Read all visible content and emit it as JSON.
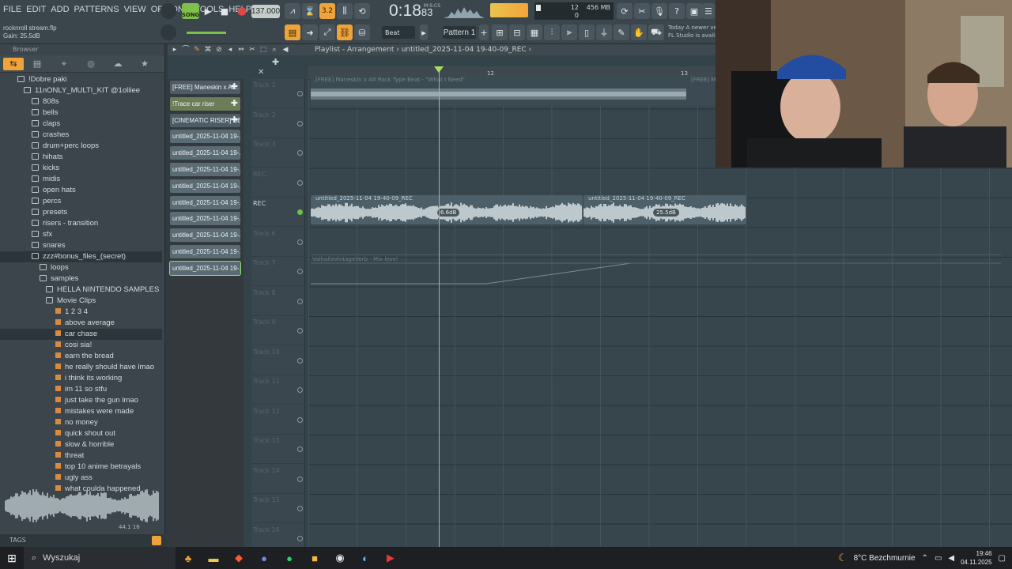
{
  "menu": [
    "FILE",
    "EDIT",
    "ADD",
    "PATTERNS",
    "VIEW",
    "OPTIONS",
    "TOOLS",
    "HELP"
  ],
  "hint": {
    "file": "rocknroll stream.flp",
    "gain": "Gain: 25.5dB"
  },
  "transport": {
    "song_label": "SONG",
    "tempo": "137.000",
    "time": "0:18",
    "time_frac": "83",
    "time_unit": "M:S:CS",
    "step": "3.2"
  },
  "cpu": {
    "voices": "12",
    "memory": "456 MB",
    "zero": "0"
  },
  "news": {
    "line1": "Today  A newer ve",
    "line2": "FL Studio is availa"
  },
  "toolbar": {
    "beat": "Beat",
    "pattern": "Pattern 1"
  },
  "browser": {
    "header": "Browser",
    "tree": [
      {
        "label": "!Dobre paki",
        "level": 0,
        "type": "folder"
      },
      {
        "label": "11nONLY_MULTI_KIT @1olliee",
        "level": 1,
        "type": "folder"
      },
      {
        "label": "808s",
        "level": 2,
        "type": "folder"
      },
      {
        "label": "bells",
        "level": 2,
        "type": "folder"
      },
      {
        "label": "claps",
        "level": 2,
        "type": "folder"
      },
      {
        "label": "crashes",
        "level": 2,
        "type": "folder"
      },
      {
        "label": "drum+perc loops",
        "level": 2,
        "type": "folder"
      },
      {
        "label": "hihats",
        "level": 2,
        "type": "folder"
      },
      {
        "label": "kicks",
        "level": 2,
        "type": "folder"
      },
      {
        "label": "midis",
        "level": 2,
        "type": "folder"
      },
      {
        "label": "open hats",
        "level": 2,
        "type": "folder"
      },
      {
        "label": "percs",
        "level": 2,
        "type": "folder"
      },
      {
        "label": "presets",
        "level": 2,
        "type": "folder"
      },
      {
        "label": "risers - transition",
        "level": 2,
        "type": "folder"
      },
      {
        "label": "sfx",
        "level": 2,
        "type": "folder"
      },
      {
        "label": "snares",
        "level": 2,
        "type": "folder"
      },
      {
        "label": "zzz#bonus_files_(secret)",
        "level": 2,
        "type": "folder",
        "selected": true
      },
      {
        "label": "loops",
        "level": 3,
        "type": "folder"
      },
      {
        "label": "samples",
        "level": 3,
        "type": "folder"
      },
      {
        "label": "HELLA NINTENDO SAMPLES",
        "level": 4,
        "type": "folder"
      },
      {
        "label": "Movie Clips",
        "level": 4,
        "type": "folder"
      },
      {
        "label": "1 2 3 4",
        "level": 5,
        "type": "file"
      },
      {
        "label": "above average",
        "level": 5,
        "type": "file"
      },
      {
        "label": "car chase",
        "level": 5,
        "type": "file",
        "selected": true
      },
      {
        "label": "cosi sia!",
        "level": 5,
        "type": "file"
      },
      {
        "label": "earn the bread",
        "level": 5,
        "type": "file"
      },
      {
        "label": "he really should have lmao",
        "level": 5,
        "type": "file"
      },
      {
        "label": "i think its working",
        "level": 5,
        "type": "file"
      },
      {
        "label": "im 11 so stfu",
        "level": 5,
        "type": "file"
      },
      {
        "label": "just take the gun lmao",
        "level": 5,
        "type": "file"
      },
      {
        "label": "mistakes were made",
        "level": 5,
        "type": "file"
      },
      {
        "label": "no money",
        "level": 5,
        "type": "file"
      },
      {
        "label": "quick shout out",
        "level": 5,
        "type": "file"
      },
      {
        "label": "slow & horrible",
        "level": 5,
        "type": "file"
      },
      {
        "label": "threat",
        "level": 5,
        "type": "file"
      },
      {
        "label": "top 10 anime betrayals",
        "level": 5,
        "type": "file"
      },
      {
        "label": "ugly ass",
        "level": 5,
        "type": "file"
      },
      {
        "label": "what coulda happened",
        "level": 5,
        "type": "file"
      }
    ],
    "preview_info": "44.1  16",
    "tags": "TAGS"
  },
  "playlist": {
    "title": "Playlist - Arrangement",
    "pattern": "untitled_2025-11-04 19-40-09_REC",
    "ruler": [
      "12",
      "13"
    ],
    "patterns": [
      {
        "label": "[FREE] Maneskin x Al...",
        "style": "dk",
        "plus": true
      },
      {
        "label": "!Trace car riser",
        "style": "gr",
        "plus": true
      },
      {
        "label": "[CINEMATIC RISER] SE...",
        "style": "dk",
        "plus": true
      },
      {
        "label": "untitled_2025-11-04 19-...",
        "style": "",
        "plus": false
      },
      {
        "label": "untitled_2025-11-04 19-...",
        "style": "",
        "plus": false
      },
      {
        "label": "untitled_2025-11-04 19-...",
        "style": "",
        "plus": false
      },
      {
        "label": "untitled_2025-11-04 19-...",
        "style": "",
        "plus": false
      },
      {
        "label": "untitled_2025-11-04 19-...",
        "style": "",
        "plus": false
      },
      {
        "label": "untitled_2025-11-04 19-...",
        "style": "",
        "plus": false
      },
      {
        "label": "untitled_2025-11-04 19-...",
        "style": "",
        "plus": false
      },
      {
        "label": "untitled_2025-11-04 19-...",
        "style": "",
        "plus": false
      },
      {
        "label": "untitled_2025-11-04 19-...",
        "style": "sel",
        "plus": false
      }
    ],
    "tracks": [
      "Track 1",
      "Track 2",
      "Track 3",
      "REC",
      "REC",
      "Track 6",
      "Track 7",
      "Track 8",
      "Track 9",
      "Track 10",
      "Track 11",
      "Track 12",
      "Track 13",
      "Track 14",
      "Track 15",
      "Track 16"
    ],
    "clips": {
      "top": "[FREE] Maneskin x Alt Rock Type Beat - \"What I Need\"",
      "top2": "[FREE] Ma",
      "rec1": "untitled_2025-11-04 19-40-09_REC",
      "rec2": "untitled_2025-11-04 19-40-09_REC",
      "gain1": "6.6dB",
      "gain2": "25.5dB",
      "auto": "ValhallaVintageVerb - Mix level"
    }
  },
  "taskbar": {
    "search": "Wyszukaj",
    "weather": "8°C  Bezchmurnie",
    "time": "19:46",
    "date": "04.11.2025"
  }
}
